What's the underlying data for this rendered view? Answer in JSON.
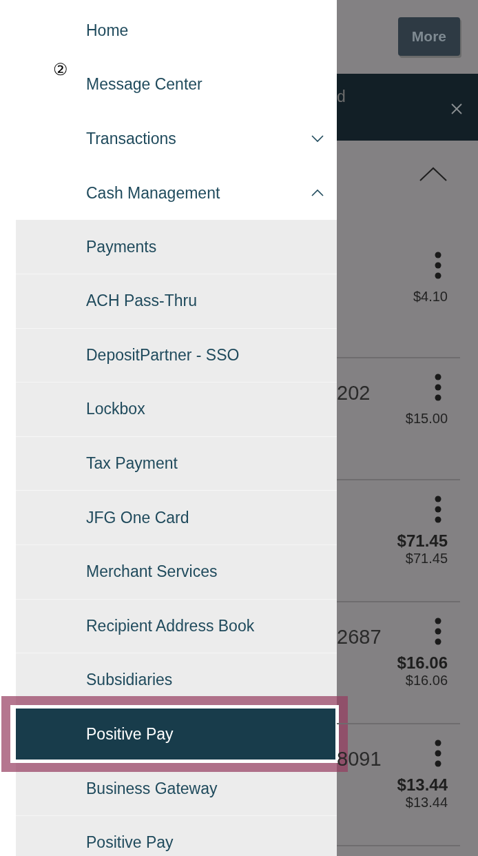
{
  "menu": [
    {
      "label": "Home",
      "kind": "link"
    },
    {
      "label": "Message Center",
      "kind": "link",
      "step_marker": "②"
    },
    {
      "label": "Transactions",
      "kind": "group",
      "expanded": false
    },
    {
      "label": "Cash Management",
      "kind": "group",
      "expanded": true,
      "children": [
        {
          "label": "Payments",
          "selected": false,
          "highlighted": false
        },
        {
          "label": "ACH Pass-Thru",
          "selected": false,
          "highlighted": false
        },
        {
          "label": "DepositPartner - SSO",
          "selected": false,
          "highlighted": false
        },
        {
          "label": "Lockbox",
          "selected": false,
          "highlighted": false
        },
        {
          "label": "Tax Payment",
          "selected": false,
          "highlighted": false
        },
        {
          "label": "JFG One Card",
          "selected": false,
          "highlighted": false
        },
        {
          "label": "Merchant Services",
          "selected": false,
          "highlighted": false
        },
        {
          "label": "Recipient Address Book",
          "selected": false,
          "highlighted": false
        },
        {
          "label": "Subsidiaries",
          "selected": false,
          "highlighted": false
        },
        {
          "label": "Positive Pay",
          "selected": true,
          "highlighted": true
        },
        {
          "label": "Business Gateway",
          "selected": false,
          "highlighted": false
        },
        {
          "label": "Positive Pay",
          "selected": false,
          "highlighted": false
        }
      ]
    }
  ],
  "background": {
    "button": "More",
    "banner_text": "d",
    "rows": [
      {
        "sub_amount": "$4.10"
      },
      {
        "reference": "202",
        "sub_amount": "$15.00"
      },
      {
        "amount": "$71.45",
        "sub_amount": "$71.45"
      },
      {
        "reference": "2687",
        "amount": "$16.06",
        "sub_amount": "$16.06"
      },
      {
        "reference": "8091",
        "amount": "$13.44",
        "sub_amount": "$13.44"
      }
    ]
  }
}
